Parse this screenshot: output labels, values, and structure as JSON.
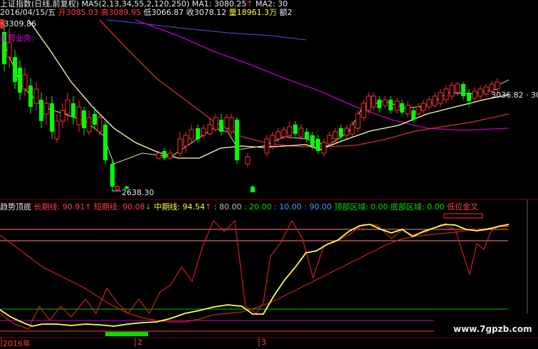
{
  "header": {
    "title": "上证指数(日线,前复权)",
    "ma_params": "MA5(2,13,34,55,2,120,250)",
    "ma1_label": "MA1: 3080.25",
    "ma2_label": "MA2: 30",
    "up_arrow": "↑",
    "date": "2016/04/15/五",
    "open_label": "开",
    "open_value": "3085.03",
    "high_label": "高",
    "high_value": "3089.95",
    "low_label": "低",
    "low_value": "3066.87",
    "close_label": "收",
    "close_value": "3078.12",
    "vol_label": "量",
    "vol_value": "18961.3万",
    "amt_label": "额2"
  },
  "main_chart": {
    "label_high": "3309.86",
    "label_low": "2638.30",
    "label_last": "3036.82 · 30",
    "business_label": "主营业务:"
  },
  "indicator": {
    "name": "趋势顶底",
    "long_label": "长期线: 90.91",
    "short_label": "短期线: 90.08",
    "mid_label": "中期线: 94.54",
    "level_80": ": 80.00",
    "level_20": ": 20.00",
    "level_10": ": 10.00",
    "level_90": ": 90.00",
    "top_zone": "顶部区域: 0.00",
    "bottom_zone": "底部区域: 0.00",
    "low_gold": "低位金叉",
    "up_arrow": "↑",
    "down_arrow": "↓"
  },
  "x_axis": {
    "label_year": "2016年",
    "label_2": "2",
    "label_3": "3"
  },
  "watermark": "www.7gpzb.com",
  "colors": {
    "up": "#ff3030",
    "down": "#00ff00",
    "ma_short": "#ffffc0",
    "ma_mid": "#ff3030",
    "ma_long": "#c000c0",
    "ma_longest": "#4040c0"
  }
}
